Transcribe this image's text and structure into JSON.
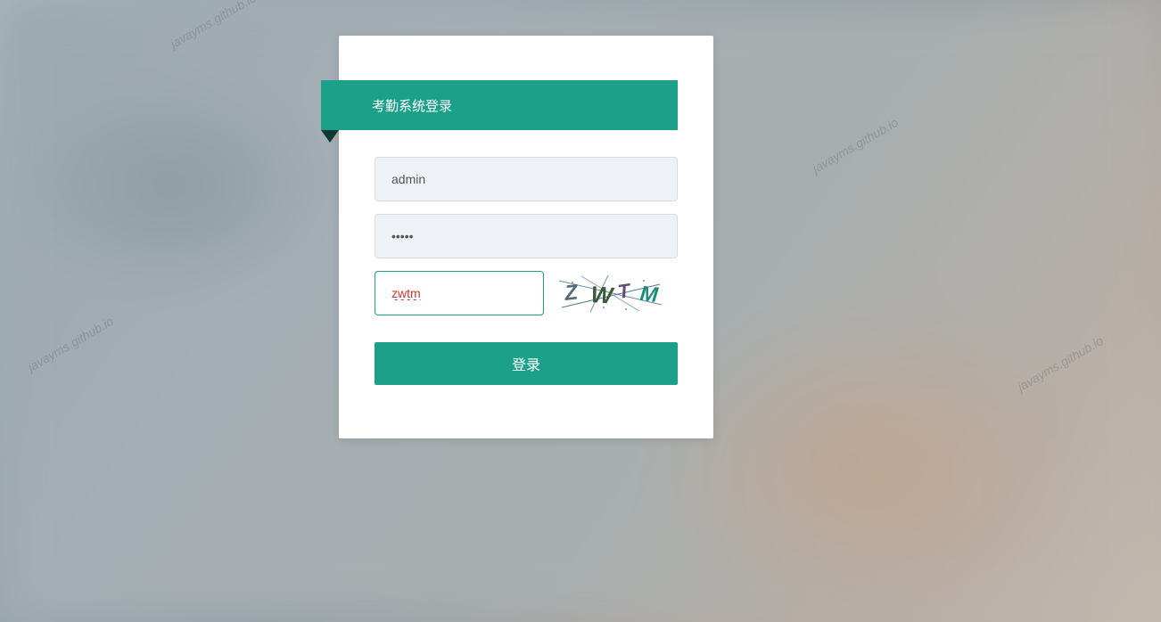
{
  "watermark": "javayms.github.io",
  "login": {
    "title": "考勤系统登录",
    "username_value": "admin",
    "password_value": "•••••",
    "captcha_value": "zwtm",
    "captcha_text": "ZWTM",
    "submit_label": "登录"
  }
}
